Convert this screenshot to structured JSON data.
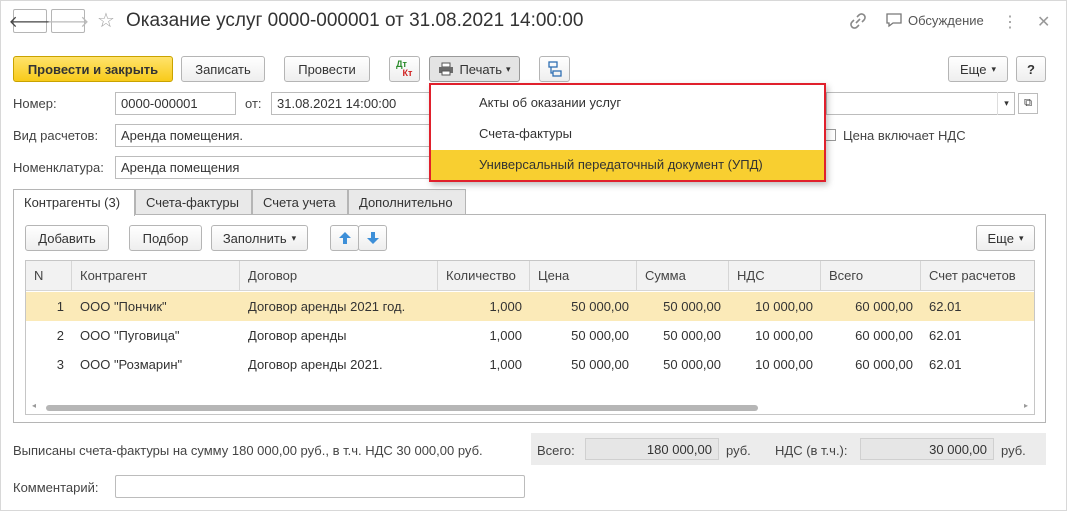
{
  "header": {
    "title": "Оказание услуг 0000-000001 от 31.08.2021 14:00:00",
    "discussion_label": "Обсуждение"
  },
  "toolbar": {
    "post_close": "Провести и закрыть",
    "save": "Записать",
    "post": "Провести",
    "dtkt_top": "Дт",
    "dtkt_bottom": "Кт",
    "print": "Печать",
    "more": "Еще",
    "help": "?"
  },
  "print_menu": {
    "items": [
      "Акты об оказании услуг",
      "Счета-фактуры",
      "Универсальный передаточный документ (УПД)"
    ]
  },
  "form": {
    "number_label": "Номер:",
    "number_value": "0000-000001",
    "date_label": "от:",
    "date_value": "31.08.2021 14:00:00",
    "calc_type_label": "Вид расчетов:",
    "calc_type_value": "Аренда помещения.",
    "vat_included_label": "Цена включает НДС",
    "nomenclature_label": "Номенклатура:",
    "nomenclature_value": "Аренда помещения"
  },
  "tabs": [
    "Контрагенты (3)",
    "Счета-фактуры",
    "Счета учета",
    "Дополнительно"
  ],
  "table_toolbar": {
    "add": "Добавить",
    "pick": "Подбор",
    "fill": "Заполнить",
    "more": "Еще"
  },
  "table": {
    "columns": [
      "N",
      "Контрагент",
      "Договор",
      "Количество",
      "Цена",
      "Сумма",
      "НДС",
      "Всего",
      "Счет расчетов"
    ],
    "rows": [
      [
        "1",
        "ООО \"Пончик\"",
        "Договор аренды 2021 год.",
        "1,000",
        "50 000,00",
        "50 000,00",
        "10 000,00",
        "60 000,00",
        "62.01"
      ],
      [
        "2",
        "ООО \"Пуговица\"",
        "Договор аренды",
        "1,000",
        "50 000,00",
        "50 000,00",
        "10 000,00",
        "60 000,00",
        "62.01"
      ],
      [
        "3",
        "ООО \"Розмарин\"",
        "Договор аренды 2021.",
        "1,000",
        "50 000,00",
        "50 000,00",
        "10 000,00",
        "60 000,00",
        "62.01"
      ]
    ],
    "selected_row": 0
  },
  "footer": {
    "invoice_note": "Выписаны счета-фактуры на сумму 180 000,00 руб., в т.ч. НДС 30 000,00 руб.",
    "total_label": "Всего:",
    "total_value": "180 000,00",
    "currency": "руб.",
    "vat_label": "НДС (в т.ч.):",
    "vat_value": "30 000,00",
    "currency2": "руб.",
    "comment_label": "Комментарий:",
    "comment_value": ""
  },
  "colors": {
    "accent_yellow": "#f8cb1a",
    "highlight_row": "#fbeab8",
    "menu_highlight": "#f8cf30",
    "popup_border": "#e0202c",
    "arrow_blue": "#3d8fd8"
  }
}
